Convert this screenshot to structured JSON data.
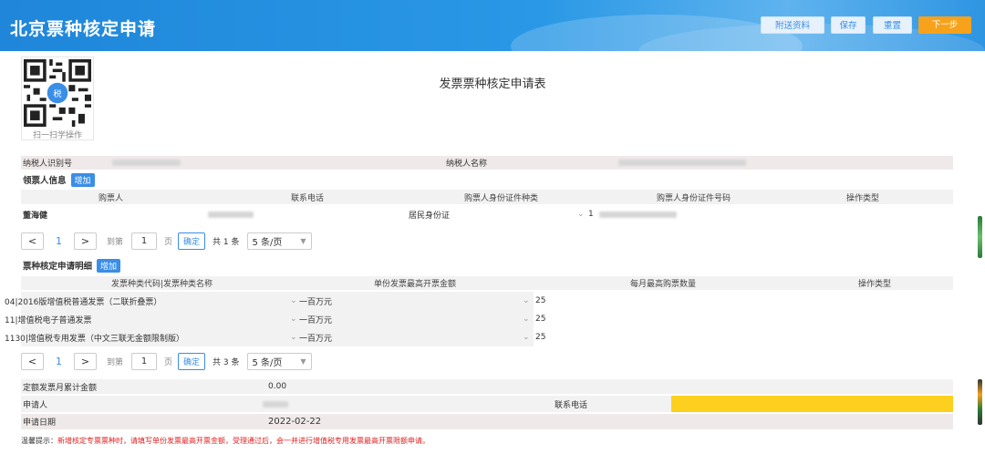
{
  "header": {
    "title": "北京票种核定申请",
    "buttons": {
      "attach": "附送资料",
      "save": "保存",
      "reset": "重置",
      "next": "下一步"
    }
  },
  "qr": {
    "caption": "扫一扫学操作"
  },
  "form": {
    "title": "发票票种核定申请表",
    "taxpayer_id_label": "纳税人识别号",
    "taxpayer_name_label": "纳税人名称"
  },
  "buyers": {
    "section_title": "领票人信息",
    "add_label": "增加",
    "columns": [
      "购票人",
      "联系电话",
      "购票人身份证件种类",
      "购票人身份证件号码",
      "操作类型"
    ],
    "rows": [
      {
        "name": "董海健",
        "id_type": "居民身份证",
        "id_prefix": "1"
      }
    ],
    "pager": {
      "page": "1",
      "goto_label": "到第",
      "goto_value": "1",
      "page_unit": "页",
      "ok": "确定",
      "total": "共 1 条",
      "size": "5 条/页"
    }
  },
  "invoice": {
    "section_title": "票种核定申请明细",
    "add_label": "增加",
    "columns": [
      "发票种类代码|发票种类名称",
      "单份发票最高开票金额",
      "每月最高购票数量",
      "操作类型"
    ],
    "rows": [
      {
        "type": "04|2016版增值税普通发票（二联折叠票）",
        "max_amount": "一百万元",
        "qty": "25"
      },
      {
        "type": "11|增值税电子普通发票",
        "max_amount": "一百万元",
        "qty": "25"
      },
      {
        "type": "1130|增值税专用发票（中文三联无金额限制版）",
        "max_amount": "一百万元",
        "qty": "25"
      }
    ],
    "pager": {
      "page": "1",
      "goto_label": "到第",
      "goto_value": "1",
      "page_unit": "页",
      "ok": "确定",
      "total": "共 3 条",
      "size": "5 条/页"
    }
  },
  "summary": {
    "monthly_total_label": "定额发票月累计金额",
    "monthly_total_value": "0.00",
    "applicant_label": "申请人",
    "phone_label": "联系电话",
    "date_label": "申请日期",
    "date_value": "2022-02-22"
  },
  "hint": {
    "prefix": "温馨提示：",
    "text": "新增核定专票票种时，请填写单份发票最高开票金额，受理通过后，会一并进行增值税专用发票最高开票限额申请。"
  },
  "colors": {
    "header_blue": "#2a98e6",
    "accent": "#3a8ee6",
    "next_orange": "#f7a21b",
    "highlight_yellow": "#fdd020",
    "hint_red": "#e02020"
  }
}
